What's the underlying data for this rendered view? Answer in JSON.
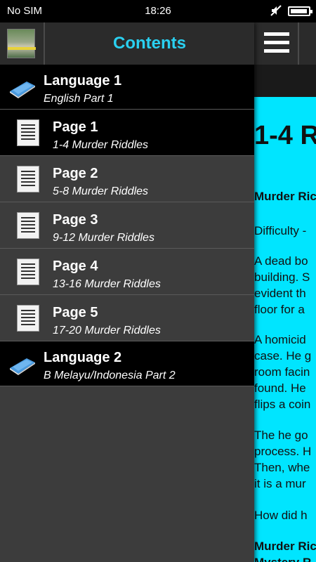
{
  "status_bar": {
    "carrier": "No SIM",
    "time": "18:26",
    "battery_level": 0.95
  },
  "drawer": {
    "title": "Contents",
    "rows": [
      {
        "kind": "group",
        "title": "Language 1",
        "subtitle": "English Part 1",
        "icon": "book-icon"
      },
      {
        "kind": "item",
        "title": "Page 1",
        "subtitle": "1-4 Murder Riddles",
        "icon": "document-icon",
        "active": true
      },
      {
        "kind": "item",
        "title": "Page 2",
        "subtitle": "5-8 Murder Riddles",
        "icon": "document-icon"
      },
      {
        "kind": "item",
        "title": "Page 3",
        "subtitle": "9-12 Murder Riddles",
        "icon": "document-icon"
      },
      {
        "kind": "item",
        "title": "Page 4",
        "subtitle": "13-16 Murder Riddles",
        "icon": "document-icon"
      },
      {
        "kind": "item",
        "title": "Page 5",
        "subtitle": "17-20 Murder Riddles",
        "icon": "document-icon"
      },
      {
        "kind": "group",
        "title": "Language 2",
        "subtitle": "B Melayu/Indonesia Part 2",
        "icon": "book-icon"
      }
    ]
  },
  "content": {
    "heading": "1-4 R",
    "paragraphs": [
      "Murder Ric",
      "Difficulty -",
      "A dead bo\nbuilding. S\nevident th\nfloor for a",
      "A homicid\ncase. He g\nroom facin\nfound. He\nflips a coin",
      "The he go\nprocess. H\nThen, whe\nit is a mur",
      "How did h",
      "Murder Ric\nMystery R"
    ]
  },
  "colors": {
    "accent": "#2ad0f0",
    "page_bg": "#00e5ff",
    "drawer_bg": "#3c3c3c"
  }
}
